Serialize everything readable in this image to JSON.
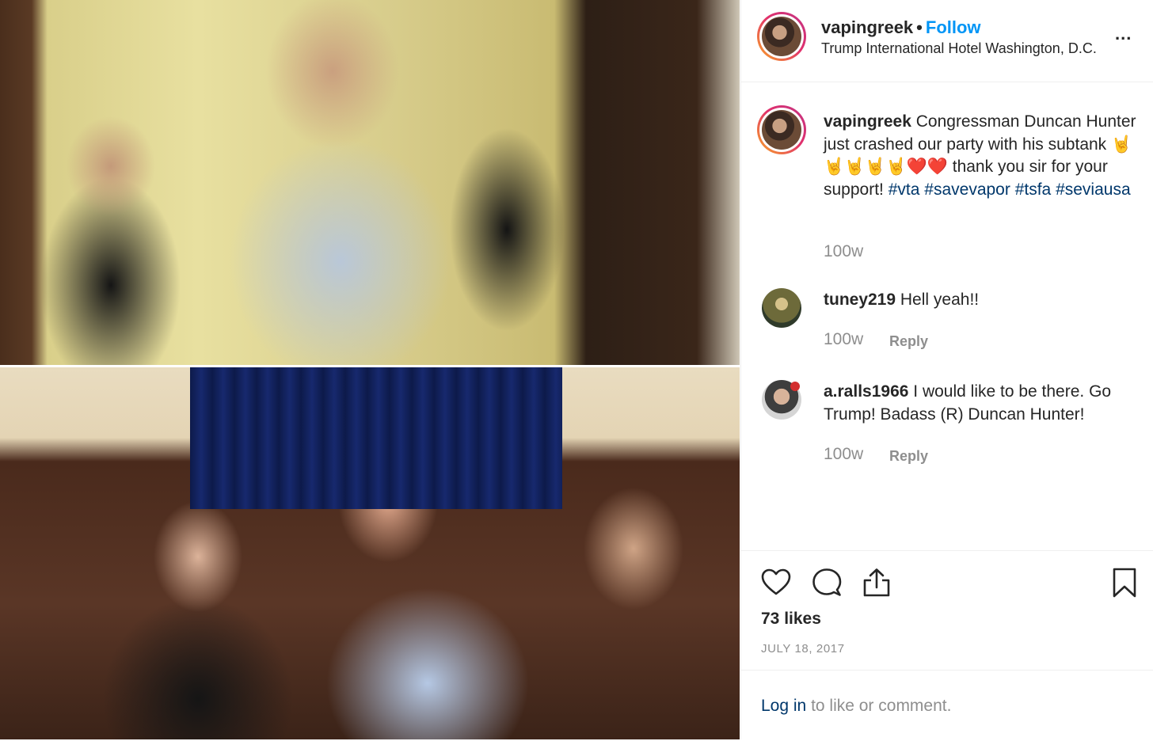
{
  "post": {
    "username": "vapingreek",
    "separator": "•",
    "follow_label": "Follow",
    "location": "Trump International Hotel Washington, D.C.",
    "more_label": "...",
    "caption": {
      "username": "vapingreek",
      "text_before": "Congressman Duncan Hunter just crashed our party with his subtank",
      "emojis": "🤘🤘🤘🤘🤘❤️❤️",
      "text_after": "thank you sir for your support!",
      "hashtags": [
        "#vta",
        "#savevapor",
        "#tsfa",
        "#seviausa"
      ],
      "time": "100w"
    },
    "comments": [
      {
        "username": "tuney219",
        "text": "Hell yeah!!",
        "time": "100w",
        "reply_label": "Reply"
      },
      {
        "username": "a.ralls1966",
        "text": "I would like to be there. Go Trump! Badass (R) Duncan Hunter!",
        "time": "100w",
        "reply_label": "Reply"
      }
    ],
    "likes": "73 likes",
    "date": "JULY 18, 2017",
    "login": {
      "link_label": "Log in",
      "rest": "to like or comment."
    }
  },
  "icons": {
    "like": "heart-icon",
    "comment": "comment-icon",
    "share": "share-icon",
    "save": "bookmark-icon"
  },
  "colors": {
    "follow": "#0095f6",
    "hashtag": "#00376b",
    "muted": "#8e8e8e",
    "text": "#262626"
  }
}
